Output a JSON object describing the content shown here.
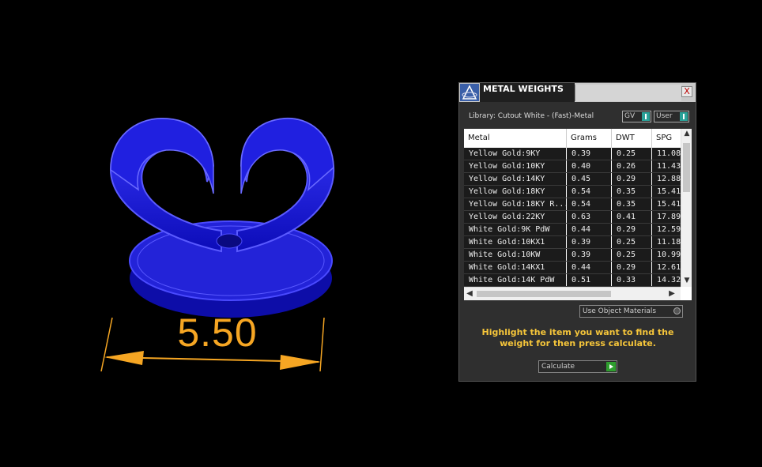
{
  "viewport": {
    "dimension_label": "5.50"
  },
  "panel": {
    "title": "METAL WEIGHTS",
    "close_label": "X",
    "library_label": "Library: Cutout White - (Fast)-Metal",
    "gv_label": "GV",
    "user_label": "User",
    "columns": [
      "Metal",
      "Grams",
      "DWT",
      "SPG"
    ],
    "rows": [
      [
        "Yellow Gold:9KY",
        "0.39",
        "0.25",
        "11.08"
      ],
      [
        "Yellow Gold:10KY",
        "0.40",
        "0.26",
        "11.43"
      ],
      [
        "Yellow Gold:14KY",
        "0.45",
        "0.29",
        "12.88"
      ],
      [
        "Yellow Gold:18KY",
        "0.54",
        "0.35",
        "15.41"
      ],
      [
        "Yellow Gold:18KY R...",
        "0.54",
        "0.35",
        "15.41"
      ],
      [
        "Yellow Gold:22KY",
        "0.63",
        "0.41",
        "17.89"
      ],
      [
        "White Gold:9K PdW",
        "0.44",
        "0.29",
        "12.59"
      ],
      [
        "White Gold:10KX1",
        "0.39",
        "0.25",
        "11.18"
      ],
      [
        "White Gold:10KW",
        "0.39",
        "0.25",
        "10.99"
      ],
      [
        "White Gold:14KX1",
        "0.44",
        "0.29",
        "12.61"
      ],
      [
        "White Gold:14K PdW",
        "0.51",
        "0.33",
        "14.32"
      ]
    ],
    "use_object_materials_label": "Use Object Materials",
    "instruction": "Highlight the item you want to find the weight for then press calculate.",
    "calculate_label": "Calculate",
    "colors": {
      "model_blue": "#1a1aee",
      "dimension_orange": "#f6a623",
      "instruction_yellow": "#f5c53a",
      "toggle_teal": "#2aa198",
      "calculate_green": "#2f9e2f"
    }
  }
}
